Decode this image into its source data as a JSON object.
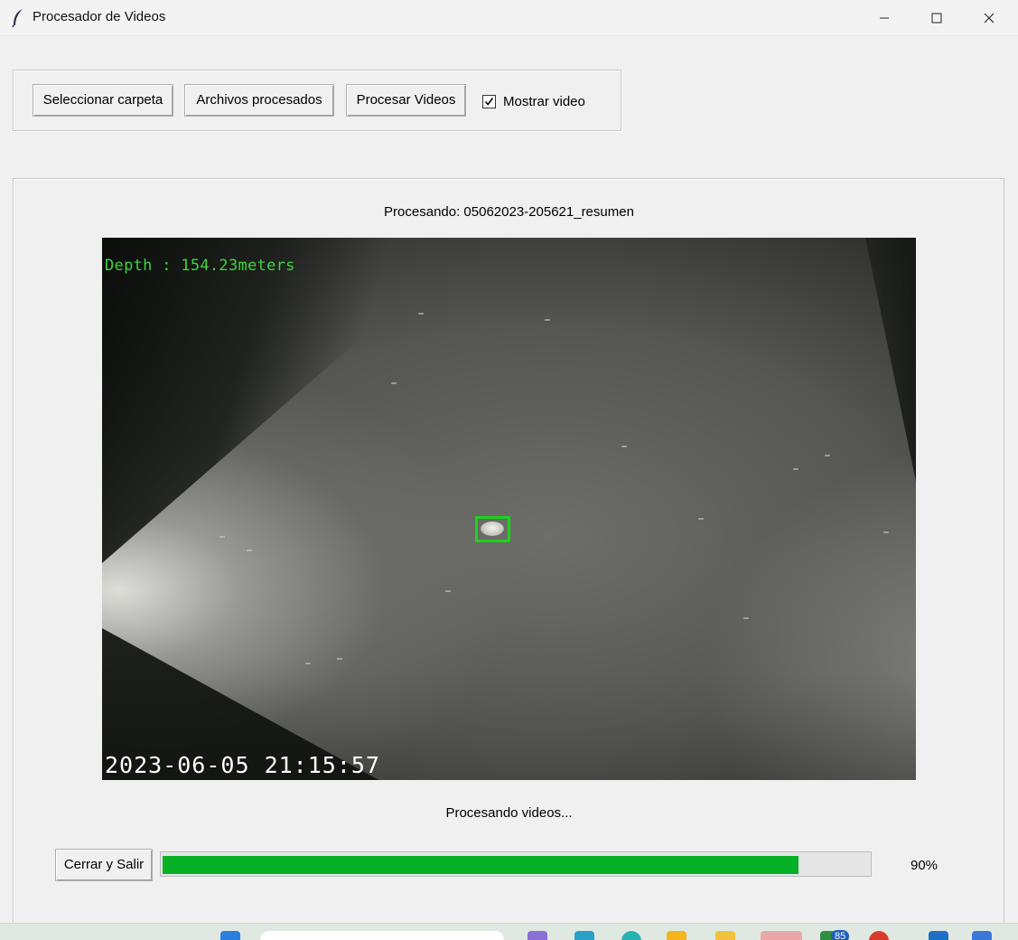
{
  "window": {
    "title": "Procesador de Videos",
    "controls": [
      "minimize",
      "maximize",
      "close"
    ]
  },
  "toolbar": {
    "select_folder_label": "Seleccionar carpeta",
    "processed_files_label": "Archivos procesados",
    "process_videos_label": "Procesar Videos",
    "show_video_label": "Mostrar video",
    "show_video_checked": true
  },
  "main": {
    "processing_file_text": "Procesando: 05062023-205621_resumen",
    "video": {
      "depth_overlay": "Depth : 154.23meters",
      "timestamp_overlay": "2023-06-05 21:15:57",
      "detection_box_color": "#1ad31a"
    },
    "status_text": "Procesando videos...",
    "close_exit_label": "Cerrar y Salir",
    "progress_value": 0.9,
    "progress_text": "90%",
    "progress_color": "#06b025"
  },
  "taskbar": {
    "badge_count": "85"
  }
}
